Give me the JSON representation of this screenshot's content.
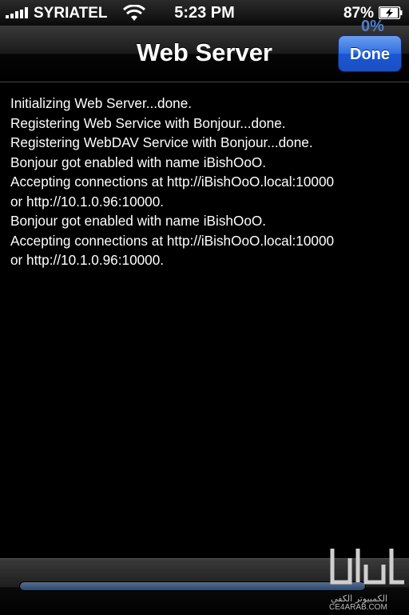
{
  "status_bar": {
    "carrier": "SYRIATEL",
    "time": "5:23 PM",
    "battery_percent": "87%",
    "icons": [
      "signal-bars-icon",
      "wifi-icon",
      "battery-charging-icon"
    ]
  },
  "nav": {
    "title": "Web Server",
    "done_label": "Done"
  },
  "log": {
    "lines": [
      "Initializing Web Server...done.",
      "Registering Web Service with Bonjour...done.",
      "Registering WebDAV Service with Bonjour...done.",
      "Bonjour got enabled with name iBishOoO.",
      "Accepting connections at http://iBishOoO.local:10000",
      "or http://10.1.0.96:10000.",
      "Bonjour got enabled with name iBishOoO.",
      "Accepting connections at http://iBishOoO.local:10000",
      "or http://10.1.0.96:10000."
    ]
  },
  "progress": {
    "label": "0%",
    "value": 0
  },
  "watermark": {
    "arabic_text": "الكمبيوتر الكفي",
    "url": "CE4ARAB.COM"
  },
  "colors": {
    "done_button": "#2f6fe0",
    "progress_label": "#4f7fd0",
    "background": "#000000"
  }
}
